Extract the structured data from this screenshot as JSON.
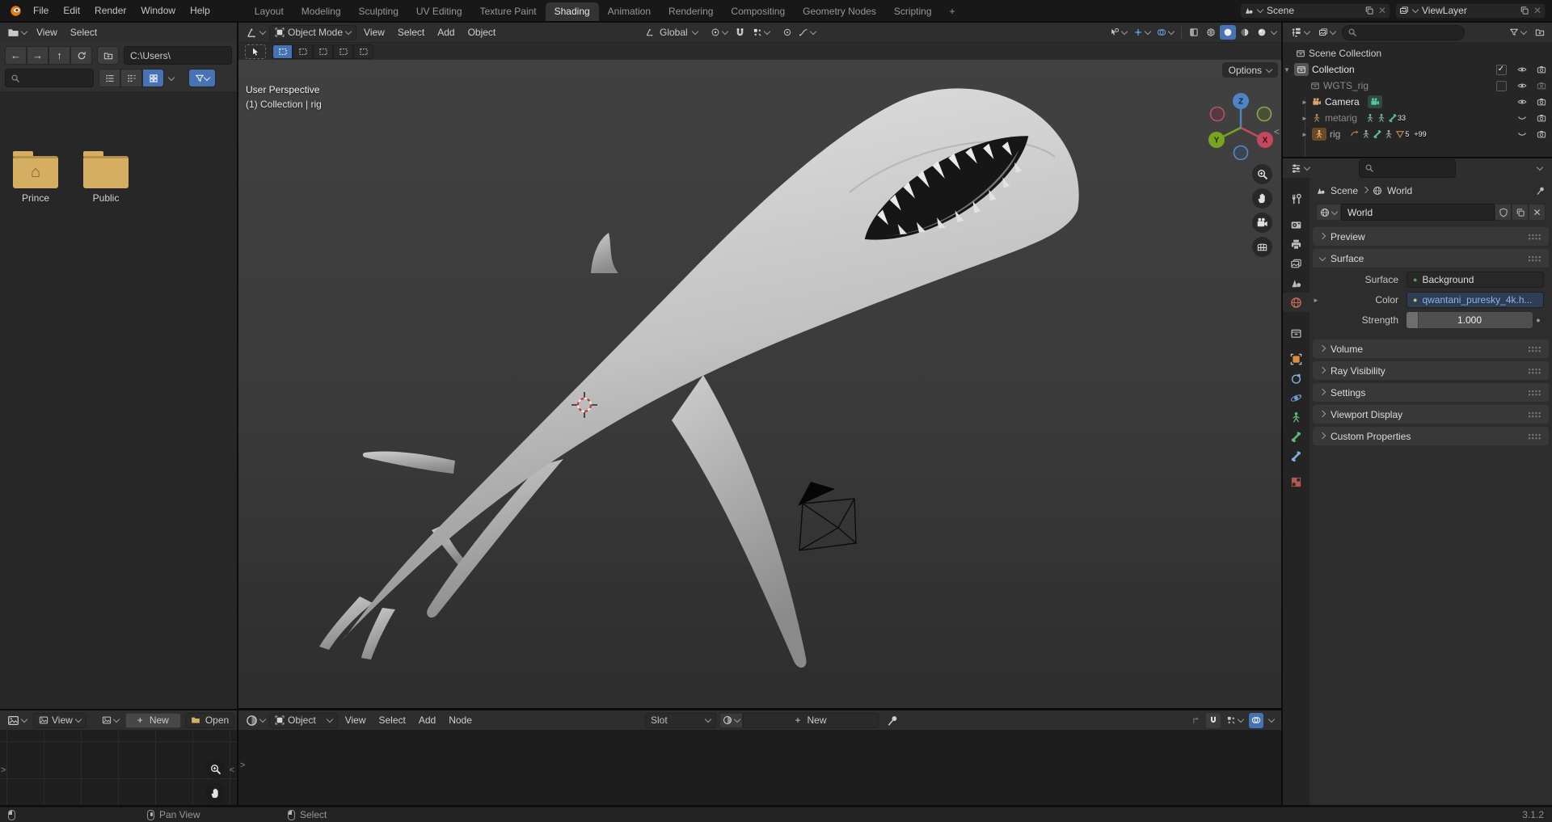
{
  "app": {
    "scene": "Scene",
    "view_layer": "ViewLayer"
  },
  "topbar": {
    "menus": [
      "File",
      "Edit",
      "Render",
      "Window",
      "Help"
    ],
    "tabs": [
      "Layout",
      "Modeling",
      "Sculpting",
      "UV Editing",
      "Texture Paint",
      "Shading",
      "Animation",
      "Rendering",
      "Compositing",
      "Geometry Nodes",
      "Scripting"
    ],
    "active_tab": "Shading",
    "add_tab_label": "+"
  },
  "icons": {
    "back": "←",
    "forward": "→",
    "up": "↑",
    "home": "⌂",
    "plus": "+",
    "close": "✕",
    "check": "✓",
    "dot": "●",
    "expand_down": "▼",
    "expand_right": "►",
    "collapse_left": "<",
    "expand_edge": ">"
  },
  "file_browser": {
    "menus": [
      "View",
      "Select"
    ],
    "path": "C:\\Users\\",
    "folders": [
      "Prince",
      "Public"
    ]
  },
  "viewport": {
    "mode": "Object Mode",
    "menus": [
      "View",
      "Select",
      "Add",
      "Object"
    ],
    "orientation": "Global",
    "options_label": "Options",
    "overlay": {
      "line1": "User Perspective",
      "line2": "(1) Collection | rig"
    },
    "gizmo": {
      "x": "X",
      "y": "Y",
      "z": "Z"
    }
  },
  "outliner": {
    "rows": [
      {
        "label": "Scene Collection"
      },
      {
        "label": "Collection"
      },
      {
        "label": "WGTS_rig"
      },
      {
        "label": "Camera"
      },
      {
        "label": "metarig",
        "badge": "33"
      },
      {
        "label": "rig",
        "badge_a": "5",
        "badge_b": "+99"
      }
    ]
  },
  "properties": {
    "breadcrumb": {
      "scene": "Scene",
      "world": "World"
    },
    "datablock": "World",
    "panels": {
      "preview": "Preview",
      "surface": "Surface",
      "volume": "Volume",
      "ray_visibility": "Ray Visibility",
      "settings": "Settings",
      "viewport_display": "Viewport Display",
      "custom_properties": "Custom Properties"
    },
    "surface": {
      "surface_label": "Surface",
      "surface_value": "Background",
      "color_label": "Color",
      "color_value": "qwantani_puresky_4k.h...",
      "strength_label": "Strength",
      "strength_value": "1.000"
    }
  },
  "image_editor": {
    "view_label": "View",
    "new_label": "New",
    "open_label": "Open"
  },
  "shader_editor": {
    "object_label": "Object",
    "menus": [
      "View",
      "Select",
      "Add",
      "Node"
    ],
    "slot_label": "Slot",
    "new_label": "New"
  },
  "status_bar": {
    "pan_view": "Pan View",
    "select_hint": "Select",
    "version": "3.1.2"
  },
  "colors": {
    "accent": "#4772b3",
    "folder": "#d6ae61",
    "link_text": "#8bb4e6",
    "world_tab_active": "#d06a5f"
  }
}
